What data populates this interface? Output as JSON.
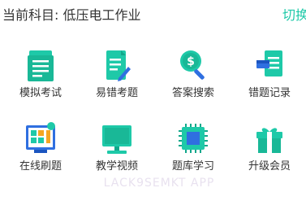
{
  "header": {
    "subject_label": "当前科目: 低压电工作业",
    "switch_label": "切换"
  },
  "colors": {
    "accent": "#1ec9a8",
    "accent_dark": "#11a88b",
    "icon_blue": "#2f6fe0",
    "icon_orange": "#f5a623",
    "text": "#333333"
  },
  "menu": {
    "items": [
      {
        "label": "模拟考试",
        "icon": "exam-paper-icon"
      },
      {
        "label": "易错考题",
        "icon": "edit-document-icon"
      },
      {
        "label": "答案搜索",
        "icon": "search-money-icon"
      },
      {
        "label": "错题记录",
        "icon": "error-record-icon"
      },
      {
        "label": "在线刷题",
        "icon": "online-practice-icon"
      },
      {
        "label": "教学视频",
        "icon": "monitor-video-icon"
      },
      {
        "label": "题库学习",
        "icon": "chip-study-icon"
      },
      {
        "label": "升级会员",
        "icon": "gift-member-icon"
      }
    ]
  },
  "watermark": "LACK9SEMKT APP"
}
